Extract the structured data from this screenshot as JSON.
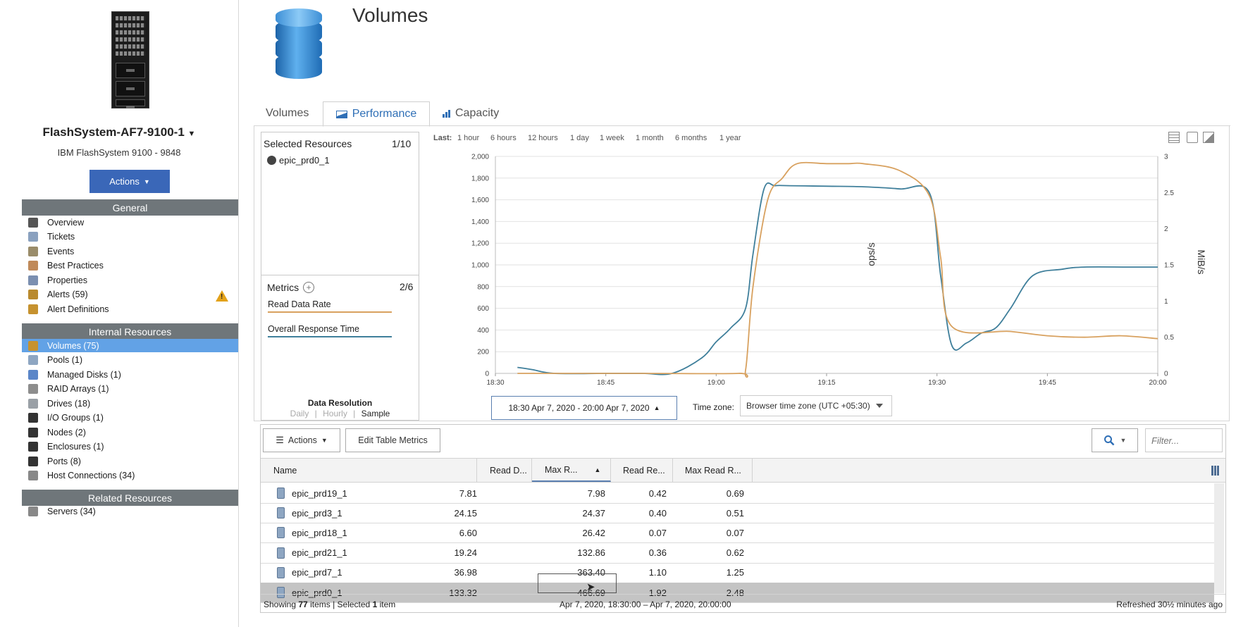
{
  "sidebar": {
    "device_name": "FlashSystem-AF7-9100-1",
    "device_model": "IBM FlashSystem 9100 - 9848",
    "actions_label": "Actions",
    "sections": {
      "general": "General",
      "internal": "Internal Resources",
      "related": "Related Resources"
    },
    "general_items": [
      {
        "label": "Overview",
        "icon": "overview-icon"
      },
      {
        "label": "Tickets",
        "icon": "ticket-icon"
      },
      {
        "label": "Events",
        "icon": "events-icon"
      },
      {
        "label": "Best Practices",
        "icon": "best-practices-icon"
      },
      {
        "label": "Properties",
        "icon": "properties-icon"
      },
      {
        "label": "Alerts (59)",
        "icon": "alerts-icon"
      },
      {
        "label": "Alert Definitions",
        "icon": "alert-definitions-icon"
      }
    ],
    "internal_items": [
      {
        "label": "Volumes (75)",
        "icon": "volumes-icon"
      },
      {
        "label": "Pools (1)",
        "icon": "pools-icon"
      },
      {
        "label": "Managed Disks (1)",
        "icon": "managed-disks-icon"
      },
      {
        "label": "RAID Arrays (1)",
        "icon": "raid-arrays-icon"
      },
      {
        "label": "Drives (18)",
        "icon": "drives-icon"
      },
      {
        "label": "I/O Groups (1)",
        "icon": "io-groups-icon"
      },
      {
        "label": "Nodes (2)",
        "icon": "nodes-icon"
      },
      {
        "label": "Enclosures (1)",
        "icon": "enclosures-icon"
      },
      {
        "label": "Ports (8)",
        "icon": "ports-icon"
      },
      {
        "label": "Host Connections (34)",
        "icon": "host-connections-icon"
      }
    ],
    "related_items": [
      {
        "label": "Servers (34)",
        "icon": "servers-icon"
      }
    ],
    "selected_item": "Volumes (75)"
  },
  "header": {
    "title": "Volumes"
  },
  "tabs": {
    "volumes": "Volumes",
    "performance": "Performance",
    "capacity": "Capacity",
    "active": "Performance"
  },
  "resources": {
    "title": "Selected Resources",
    "count": "1/10",
    "items": [
      "epic_prd0_1"
    ],
    "metrics_title": "Metrics",
    "metrics_count": "2/6",
    "metrics": [
      {
        "label": "Read Data Rate",
        "color": "#d8a15f"
      },
      {
        "label": "Overall Response Time",
        "color": "#3f7f9b"
      }
    ],
    "resolution_title": "Data Resolution",
    "resolution_options": [
      "Daily",
      "Hourly",
      "Sample"
    ],
    "resolution_separator": "|",
    "resolution_active": "Sample"
  },
  "time_controls": {
    "last_label": "Last:",
    "options": [
      "1 hour",
      "6 hours",
      "12 hours",
      "1 day",
      "1 week",
      "1 month",
      "6 months",
      "1 year"
    ],
    "range_label": "18:30 Apr 7, 2020 - 20:00 Apr 7, 2020",
    "tz_label": "Time zone:",
    "tz_value": "Browser time zone (UTC +05:30)"
  },
  "chart_data": {
    "type": "line",
    "ylabel_left": "ops/s",
    "ylabel_right": "MiB/s",
    "x_ticks": [
      "18:30",
      "18:45",
      "19:00",
      "19:15",
      "19:30",
      "19:45",
      "20:00"
    ],
    "x_range_minutes": [
      0,
      90
    ],
    "y_left_ticks": [
      "0",
      "200",
      "400",
      "600",
      "800",
      "1,000",
      "1,200",
      "1,400",
      "1,600",
      "1,800",
      "2,000"
    ],
    "ylim_left": [
      0,
      2000
    ],
    "y_right_ticks": [
      "0",
      "0.5",
      "1",
      "1.5",
      "2",
      "2.5",
      "3"
    ],
    "ylim_right": [
      0,
      3
    ],
    "grid": true,
    "series": [
      {
        "color": "#3f7f9b",
        "axis": "left",
        "x": [
          3,
          5,
          8,
          15,
          20,
          24,
          28,
          30,
          32,
          34,
          35,
          36.5,
          38,
          40,
          45,
          50,
          55,
          59,
          60.5,
          62,
          64,
          66,
          68,
          70,
          73,
          77,
          80,
          86,
          90
        ],
        "y": [
          55,
          35,
          0,
          0,
          0,
          0,
          140,
          290,
          420,
          600,
          1100,
          1700,
          1730,
          1730,
          1725,
          1720,
          1700,
          1660,
          900,
          260,
          280,
          370,
          420,
          600,
          900,
          960,
          980,
          980,
          980
        ]
      },
      {
        "color": "#d8a15f",
        "axis": "right",
        "x": [
          3,
          20,
          33,
          34,
          35,
          37,
          39,
          41,
          45,
          48,
          50,
          55,
          59,
          60.5,
          62,
          70,
          75,
          80,
          85,
          90
        ],
        "y": [
          0,
          0,
          0,
          0.05,
          1.2,
          2.4,
          2.7,
          2.9,
          2.9,
          2.9,
          2.9,
          2.8,
          2.45,
          1.6,
          0.65,
          0.58,
          0.52,
          0.5,
          0.52,
          0.48
        ]
      }
    ]
  },
  "toolbar": {
    "actions_label": "Actions",
    "edit_metrics_label": "Edit Table Metrics",
    "filter_placeholder": "Filter..."
  },
  "table": {
    "columns": [
      "Name",
      "Read D...",
      "Max R...",
      "Read Re...",
      "Max Read R..."
    ],
    "sorted_column": "Max R...",
    "rows": [
      {
        "name": "epic_prd19_1",
        "c1": "7.81",
        "c2": "7.98",
        "c3": "0.42",
        "c4": "0.69"
      },
      {
        "name": "epic_prd3_1",
        "c1": "24.15",
        "c2": "24.37",
        "c3": "0.40",
        "c4": "0.51"
      },
      {
        "name": "epic_prd18_1",
        "c1": "6.60",
        "c2": "26.42",
        "c3": "0.07",
        "c4": "0.07"
      },
      {
        "name": "epic_prd21_1",
        "c1": "19.24",
        "c2": "132.86",
        "c3": "0.36",
        "c4": "0.62"
      },
      {
        "name": "epic_prd7_1",
        "c1": "36.98",
        "c2": "363.40",
        "c3": "1.10",
        "c4": "1.25"
      },
      {
        "name": "epic_prd0_1",
        "c1": "133.32",
        "c2": "466.69",
        "c3": "1.92",
        "c4": "2.48"
      }
    ],
    "selected_row": "epic_prd0_1"
  },
  "status": {
    "showing_prefix": "Showing",
    "showing_count": "77",
    "showing_mid": "items | Selected",
    "selected_count": "1",
    "showing_suffix": "item",
    "range": "Apr 7, 2020, 18:30:00 – Apr 7, 2020, 20:00:00",
    "refreshed": "Refreshed 30½ minutes ago"
  }
}
